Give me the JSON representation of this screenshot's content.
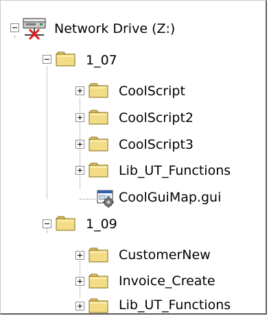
{
  "tree": {
    "root": {
      "label": "Network Drive (Z:)",
      "icon": "network-drive-icon",
      "expanded": true
    },
    "folder_1_07": {
      "label": "1_07",
      "icon": "folder-icon",
      "expanded": true,
      "children": [
        {
          "label": "CoolScript",
          "icon": "folder-icon",
          "expanded": false
        },
        {
          "label": "CoolScript2",
          "icon": "folder-icon",
          "expanded": false
        },
        {
          "label": "CoolScript3",
          "icon": "folder-icon",
          "expanded": false
        },
        {
          "label": "Lib_UT_Functions",
          "icon": "folder-icon",
          "expanded": false
        },
        {
          "label": "CoolGuiMap.gui",
          "icon": "gui-map-file-icon"
        }
      ]
    },
    "folder_1_09": {
      "label": "1_09",
      "icon": "folder-icon",
      "expanded": true,
      "children": [
        {
          "label": "CustomerNew",
          "icon": "folder-icon",
          "expanded": false
        },
        {
          "label": "Invoice_Create",
          "icon": "folder-icon",
          "expanded": false
        },
        {
          "label": "Lib_UT_Functions",
          "icon": "folder-icon",
          "expanded": false
        }
      ]
    }
  },
  "colors": {
    "folder_fill": "#f3dc86",
    "folder_tab": "#e6c766",
    "folder_outline": "#9a8236",
    "tree_line": "#8a8a8a",
    "expander_border": "#8c8c8c"
  }
}
